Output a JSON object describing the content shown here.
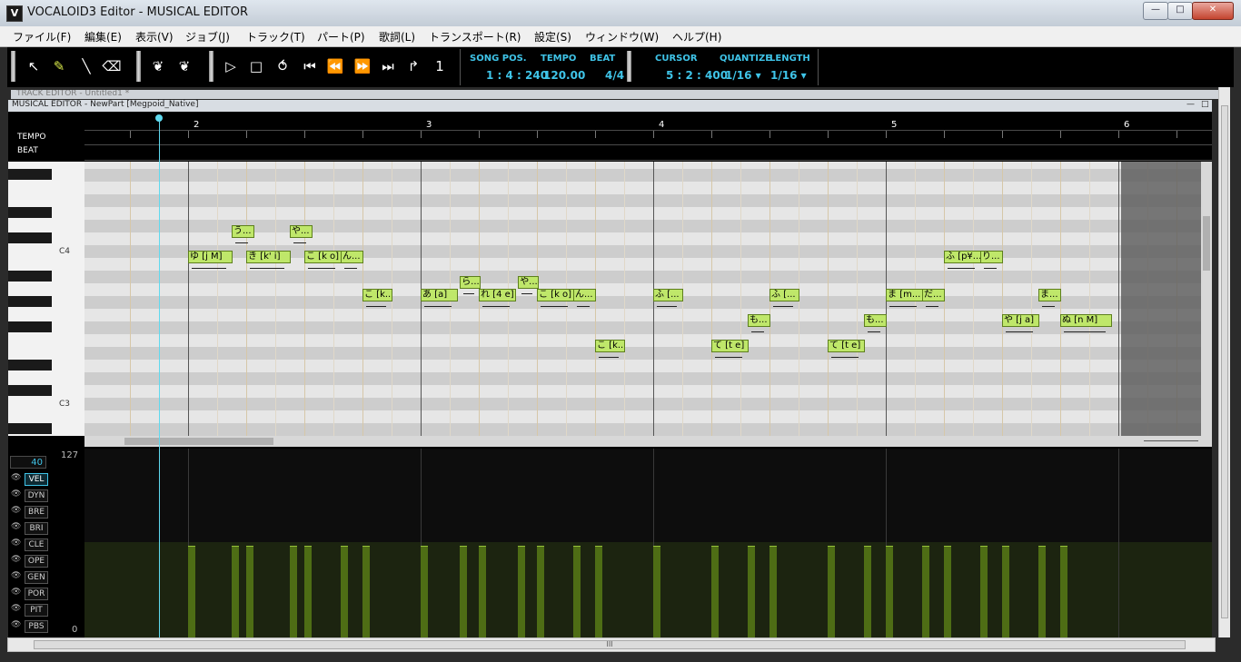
{
  "window": {
    "title": "VOCALOID3 Editor - MUSICAL EDITOR",
    "icon_letter": "V",
    "min": "—",
    "max": "□",
    "close": "✕"
  },
  "menu": [
    "ファイル(F)",
    "編集(E)",
    "表示(V)",
    "ジョブ(J)",
    "トラック(T)",
    "パート(P)",
    "歌詞(L)",
    "トランスポート(R)",
    "設定(S)",
    "ウィンドウ(W)",
    "ヘルプ(H)"
  ],
  "toolbar": {
    "song_pos_label": "SONG POS.",
    "song_pos": "1 : 4 : 240",
    "tempo_label": "TEMPO",
    "tempo": "120.00",
    "beat_label": "BEAT",
    "beat": "4/4",
    "cursor_label": "CURSOR",
    "cursor": "5 : 2 : 400",
    "quantize_label": "QUANTIZE",
    "quantize": "1/16 ▾",
    "length_label": "LENGTH",
    "length": "1/16 ▾"
  },
  "track_editor_title": "TRACK EDITOR - Untitled1 *",
  "musical_editor": {
    "title": "MUSICAL EDITOR - NewPart [Megpoid_Native]",
    "tempo_label": "TEMPO",
    "beat_label": "BEAT",
    "measures": [
      "2",
      "3",
      "4",
      "5",
      "6"
    ],
    "key_labels": {
      "c4": "C4",
      "c3": "C3"
    }
  },
  "notes": [
    {
      "text": "ゆ [j M]",
      "col": 0,
      "len": 3,
      "row": 0
    },
    {
      "text": "う...",
      "col": 3,
      "len": 1.5,
      "row": -2
    },
    {
      "text": "き [k' i]",
      "col": 4,
      "len": 3,
      "row": 0
    },
    {
      "text": "や...",
      "col": 7,
      "len": 1.5,
      "row": -2
    },
    {
      "text": "こ [k o]",
      "col": 8,
      "len": 2.5,
      "row": 0
    },
    {
      "text": "ん...",
      "col": 10.5,
      "len": 1.5,
      "row": 0
    },
    {
      "text": "こ [k...",
      "col": 12,
      "len": 2,
      "row": 3
    },
    {
      "text": "あ [a]",
      "col": 16,
      "len": 2.5,
      "row": 3
    },
    {
      "text": "ら...",
      "col": 18.7,
      "len": 1.3,
      "row": 2
    },
    {
      "text": "れ [4 e]",
      "col": 20,
      "len": 2.5,
      "row": 3
    },
    {
      "text": "や...",
      "col": 22.7,
      "len": 1.3,
      "row": 2
    },
    {
      "text": "こ [k o]",
      "col": 24,
      "len": 2.5,
      "row": 3
    },
    {
      "text": "ん...",
      "col": 26.5,
      "len": 1.5,
      "row": 3
    },
    {
      "text": "こ [k...",
      "col": 28,
      "len": 2,
      "row": 7
    },
    {
      "text": "ふ [...",
      "col": 32,
      "len": 2,
      "row": 3
    },
    {
      "text": "て [t e]",
      "col": 36,
      "len": 2.5,
      "row": 7
    },
    {
      "text": "も...",
      "col": 38.5,
      "len": 1.5,
      "row": 5
    },
    {
      "text": "ふ [...",
      "col": 40,
      "len": 2,
      "row": 3
    },
    {
      "text": "て [t e]",
      "col": 44,
      "len": 2.5,
      "row": 7
    },
    {
      "text": "も...",
      "col": 46.5,
      "len": 1.5,
      "row": 5
    },
    {
      "text": "ま [m...",
      "col": 48,
      "len": 2.5,
      "row": 3
    },
    {
      "text": "だ...",
      "col": 50.5,
      "len": 1.5,
      "row": 3
    },
    {
      "text": "ふ [p¥...",
      "col": 52,
      "len": 2.5,
      "row": 0
    },
    {
      "text": "り...",
      "col": 54.5,
      "len": 1.5,
      "row": 0
    },
    {
      "text": "や [j a]",
      "col": 56,
      "len": 2.5,
      "row": 5
    },
    {
      "text": "ま...",
      "col": 58.5,
      "len": 1.5,
      "row": 3
    },
    {
      "text": "ぬ [n M]",
      "col": 60,
      "len": 3.5,
      "row": 5
    }
  ],
  "control_track": {
    "current_value": "40",
    "max_label": "127",
    "min_label": "0",
    "eye_icon": "👁",
    "params": [
      "VEL",
      "DYN",
      "BRE",
      "BRI",
      "CLE",
      "OPE",
      "GEN",
      "POR",
      "PIT",
      "PBS"
    ],
    "active": "VEL",
    "velocity": 64
  },
  "bottom_scroll_grip": "III"
}
